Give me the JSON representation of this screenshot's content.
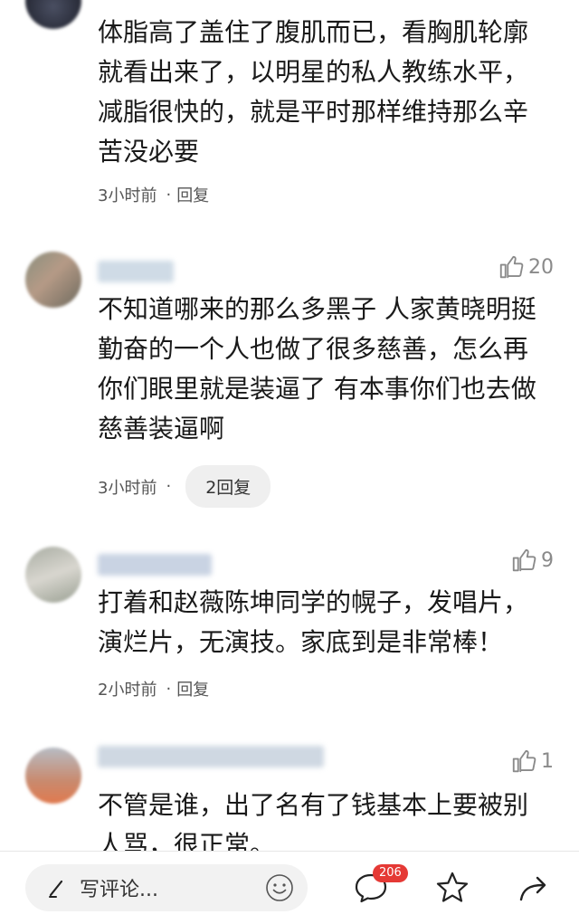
{
  "comments": [
    {
      "text": "体脂高了盖住了腹肌而已，看胸肌轮廓\n就看出来了，以明星的私人教练水平，\n减脂很快的，就是平时那样维持那么辛\n苦没必要",
      "time": "3小时前",
      "sep": "·",
      "reply": "回复"
    },
    {
      "likes": "20",
      "text": "不知道哪来的那么多黑子 人家黄晓明挺\n勤奋的一个人也做了很多慈善，怎么再\n你们眼里就是装逼了 有本事你们也去做\n慈善装逼啊",
      "time": "3小时前",
      "sep": "·",
      "reply": "2回复"
    },
    {
      "likes": "9",
      "text": "打着和赵薇陈坤同学的幌子，发唱片，\n演烂片，无演技。家底到是非常棒！",
      "time": "2小时前",
      "sep": "·",
      "reply": "回复"
    },
    {
      "likes": "1",
      "text": "不管是谁，出了名有了钱基本上要被别\n人骂，很正常。"
    }
  ],
  "bottom_bar": {
    "placeholder": "写评论...",
    "comment_count": "206",
    "icons": [
      "pen-icon",
      "smile-icon",
      "comment-icon",
      "star-icon",
      "share-icon"
    ]
  },
  "colors": {
    "badge": "#e53935",
    "muted": "#8a8a8a"
  }
}
